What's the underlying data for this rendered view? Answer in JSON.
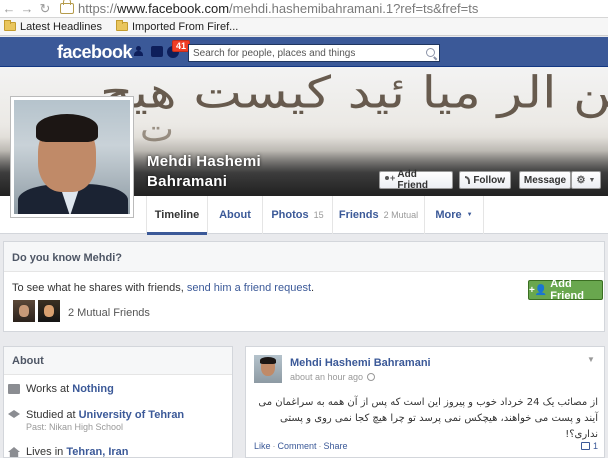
{
  "browser": {
    "back_icon": "back-arrow-icon",
    "forward_icon": "forward-arrow-icon",
    "reload_icon": "reload-icon",
    "url_prefix": "https://",
    "url_host": "www.facebook.com",
    "url_path": "/mehdi.hashemibahramani.1?ref=ts&fref=ts",
    "bookmarks": [
      {
        "label": "Latest Headlines",
        "icon": "folder-icon"
      },
      {
        "label": "Imported From Firef...",
        "icon": "folder-icon"
      }
    ]
  },
  "fb_header": {
    "logo": "facebook",
    "notification_count": "41",
    "search_placeholder": "Search for people, places and things",
    "brand_color": "#3b5998"
  },
  "cover": {
    "calligraphy_line1": "بسراغ من الر میا ئید کیست هیچ",
    "calligraphy_line2": "ت"
  },
  "profile": {
    "name_line1": "Mehdi Hashemi",
    "name_line2": "Bahramani"
  },
  "actions": {
    "add_friend": "Add Friend",
    "follow": "Follow",
    "message": "Message"
  },
  "tabs": [
    {
      "label": "Timeline",
      "count": ""
    },
    {
      "label": "About",
      "count": ""
    },
    {
      "label": "Photos",
      "count": "15"
    },
    {
      "label": "Friends",
      "count": "2 Mutual"
    },
    {
      "label": "More",
      "count": ""
    }
  ],
  "know": {
    "heading": "Do you know Mehdi?",
    "text_prefix": "To see what he shares with friends, ",
    "link": "send him a friend request",
    "text_suffix": ".",
    "button": "Add Friend",
    "mutual": "2 Mutual Friends",
    "button_color": "#69a74e"
  },
  "about": {
    "heading": "About",
    "works_prefix": "Works at ",
    "works_link": "Nothing",
    "studied_prefix": "Studied at ",
    "studied_link": "University of Tehran",
    "past": "Past: Nikan High School",
    "lives_prefix": "Lives in ",
    "lives_link": "Tehran, Iran"
  },
  "post": {
    "author": "Mehdi Hashemi Bahramani",
    "time": "about an hour ago",
    "text": "از مصائب یک 24 خرداد خوب و پیروز این است که پس از آن همه به سراغمان می آیند و پست می خواهند، هیچکس نمی پرسد تو چرا هیچ کجا نمی روی و پستی نداری؟!",
    "like": "Like",
    "comment": "Comment",
    "share": "Share",
    "share_count": "1"
  }
}
